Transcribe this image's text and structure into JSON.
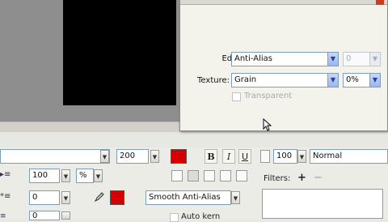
{
  "popup": {
    "edge_label": "Edge:",
    "edge_value": "Anti-Alias",
    "edge_amount": "0",
    "texture_label": "Texture:",
    "texture_value": "Grain",
    "texture_percent": "0%",
    "transparent_label": "Transparent"
  },
  "properties": {
    "font_size": "200",
    "bold": "B",
    "italic": "I",
    "underline": "U",
    "opacity": "100",
    "blend_mode": "Normal",
    "row2_value": "100",
    "row2_unit": "%",
    "indent_value": "0",
    "row4_value": "0",
    "antialias_mode": "Smooth Anti-Alias",
    "filters_label": "Filters:",
    "filters_add": "+",
    "filters_remove": "−",
    "auto_kern": "Auto kern"
  },
  "colors": {
    "fill": "#d40000"
  }
}
